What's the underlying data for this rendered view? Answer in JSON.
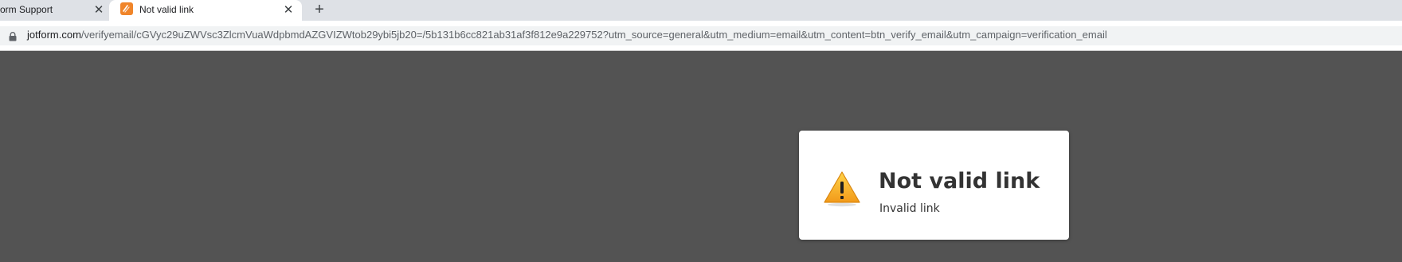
{
  "browser": {
    "tabs": [
      {
        "title": "orm Support",
        "active": false
      },
      {
        "title": "Not valid link",
        "active": true
      }
    ],
    "close_glyph": "✕",
    "newtab_glyph": "+",
    "address": {
      "host": "jotform.com",
      "path": "/verifyemail/cGVyc29uZWVsc3ZlcmVuaWdpbmdAZGVIZWtob29ybi5jb20=/5b131b6cc821ab31af3f812e9a229752?utm_source=general&utm_medium=email&utm_content=btn_verify_email&utm_campaign=verification_email"
    },
    "icons": {
      "favicon": "jotform-favicon-icon",
      "lock": "lock-icon",
      "close": "close-icon",
      "newtab": "plus-icon"
    },
    "colors": {
      "favicon": "#f0852a",
      "tabstrip": "#dee1e6"
    }
  },
  "page": {
    "background": "#535353",
    "message": {
      "title": "Not valid link",
      "detail": "Invalid link",
      "icon": "warning-icon",
      "icon_color": "#f7a01c"
    }
  }
}
